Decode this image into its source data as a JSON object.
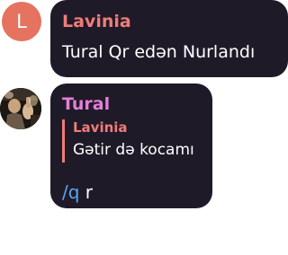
{
  "messages": [
    {
      "avatar_letter": "L",
      "sender": "Lavinia",
      "text": "Tural Qr edən Nurlandı",
      "colors": {
        "avatar": "#e5735f",
        "sender": "#f07c78"
      }
    },
    {
      "avatar_icon": "user-photo",
      "sender": "Tural",
      "reply": {
        "sender": "Lavinia",
        "text": "Gətir də kocamı"
      },
      "command": "/q",
      "argument": "r",
      "colors": {
        "sender": "#e47fd7",
        "command": "#5aa6f0"
      }
    }
  ],
  "theme": {
    "bubble_bg": "#1f1a28",
    "page_bg": "#ffffff"
  }
}
